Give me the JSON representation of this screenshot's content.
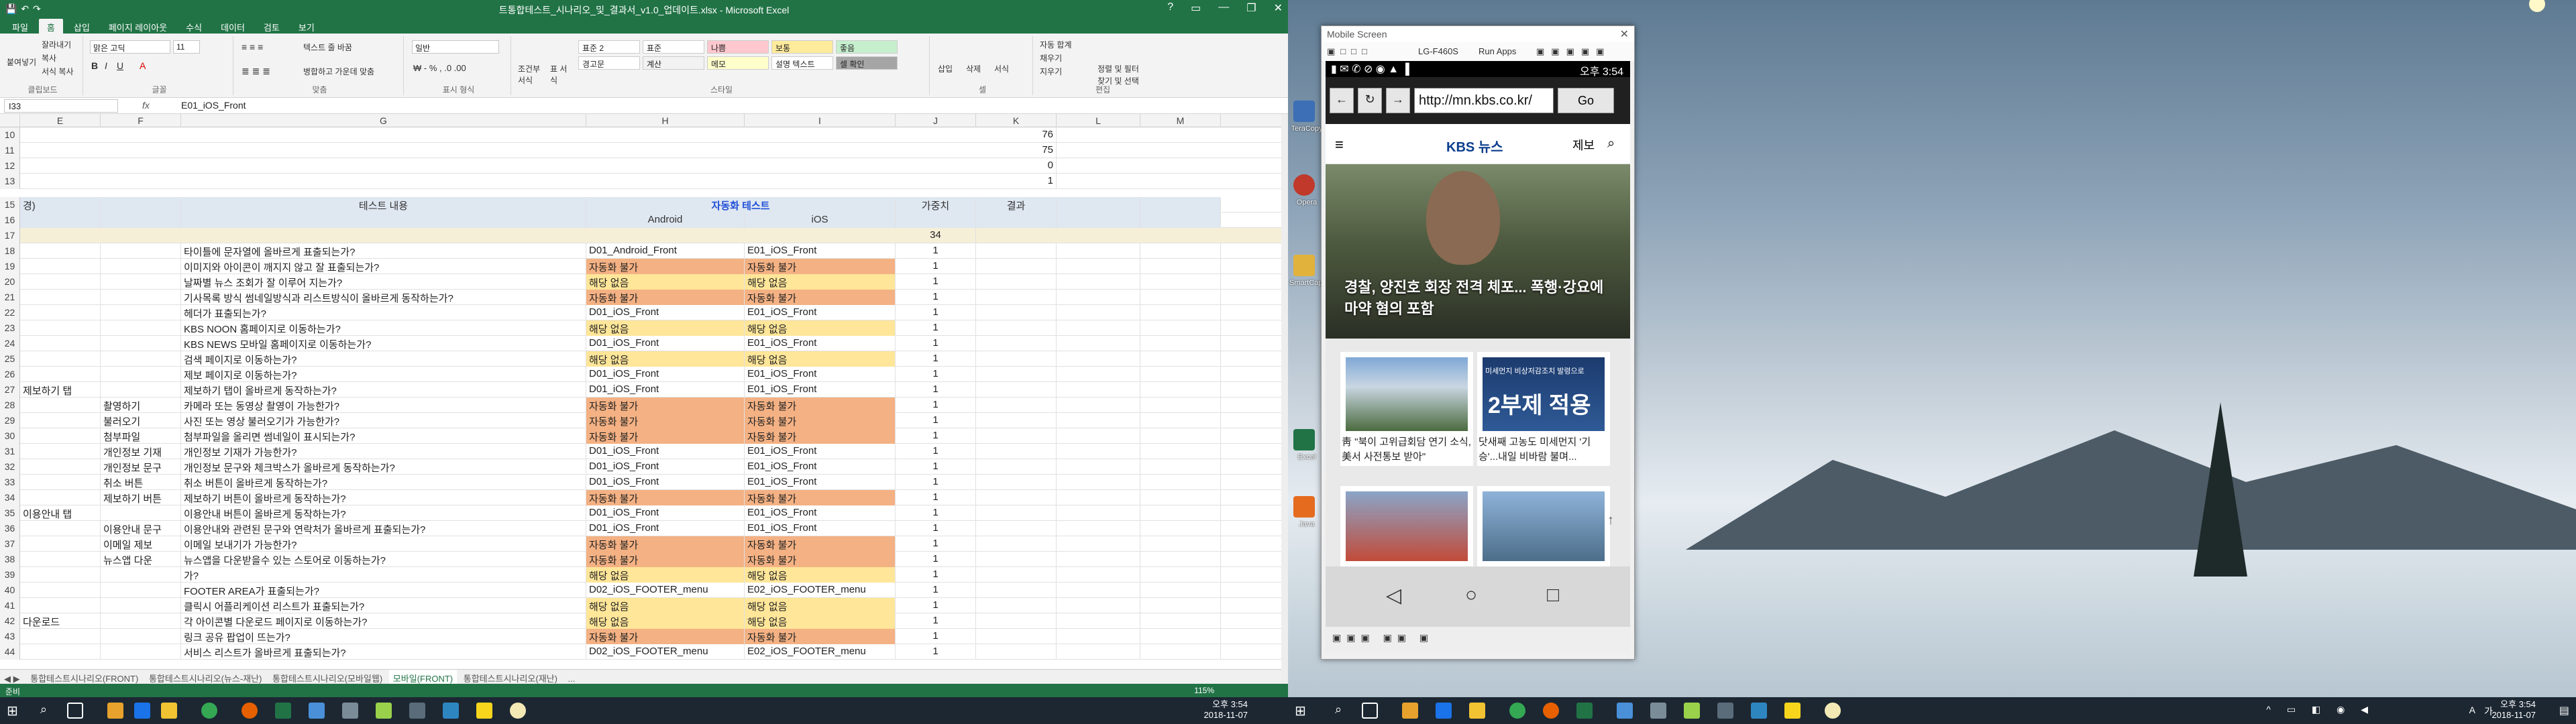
{
  "excel": {
    "title": "트통합테스트_시나리오_및_결과서_v1.0_업데이트.xlsx - Microsoft Excel",
    "ribbon_tabs": [
      "파일",
      "홈",
      "삽입",
      "페이지 레이아웃",
      "수식",
      "데이터",
      "검토",
      "보기"
    ],
    "ribbon": {
      "clipboard": {
        "cut": "잘라내기",
        "copy": "복사",
        "format_painter": "서식 복사",
        "paste": "붙여넣기",
        "label": "클립보드"
      },
      "font": {
        "name": "맑은 고딕",
        "size": "11",
        "label": "글꼴"
      },
      "alignment": {
        "wrap": "텍스트 줄 바꿈",
        "merge": "병합하고 가운데 맞춤",
        "label": "맞춤"
      },
      "number": {
        "format": "일반",
        "label": "표시 형식"
      },
      "styles": {
        "conditional": "조건부 서식",
        "table": "표 서식",
        "items": [
          {
            "label": "표준 2",
            "color": "#ffffff"
          },
          {
            "label": "표준",
            "color": "#ffffff"
          },
          {
            "label": "나쁨",
            "color": "#ffc7ce"
          },
          {
            "label": "보통",
            "color": "#ffeb9c"
          },
          {
            "label": "좋음",
            "color": "#c6efce"
          },
          {
            "label": "경고문",
            "color": "#ffffff"
          },
          {
            "label": "계산",
            "color": "#f2f2f2"
          },
          {
            "label": "메모",
            "color": "#ffffcc"
          },
          {
            "label": "설명 텍스트",
            "color": "#ffffff"
          },
          {
            "label": "셀 확인",
            "color": "#a5a5a5"
          }
        ],
        "label": "스타일"
      },
      "cells": {
        "insert": "삽입",
        "delete": "삭제",
        "format": "서식",
        "label": "셀"
      },
      "editing": {
        "autosum": "자동 합계",
        "fill": "채우기",
        "clear": "지우기",
        "sort": "정렬 및 필터",
        "find": "찾기 및 선택",
        "label": "편집"
      }
    },
    "name_box": "I33",
    "formula": "E01_iOS_Front",
    "columns": [
      "E",
      "F",
      "G",
      "H",
      "I",
      "J",
      "K",
      "L",
      "M"
    ],
    "top_rows": [
      {
        "row": "10",
        "k": "76"
      },
      {
        "row": "11",
        "k": "75"
      },
      {
        "row": "12",
        "k": "0"
      },
      {
        "row": "13",
        "k": "1"
      }
    ],
    "header_row15": {
      "row": "15",
      "e": "경)",
      "g": "테스트 내용",
      "hi": "자동화 테스트",
      "j": "가중치",
      "k": "결과"
    },
    "header_row16": {
      "row": "16",
      "h": "Android",
      "i": "iOS"
    },
    "header_row17": {
      "row": "17",
      "j": "34"
    },
    "rows": [
      {
        "row": "18",
        "e": "",
        "f": "",
        "g": "타이틀에 문자열에 올바르게 표출되는가?",
        "h": "D01_Android_Front",
        "i": "E01_iOS_Front",
        "j": "1",
        "status": "none"
      },
      {
        "row": "19",
        "e": "",
        "f": "",
        "g": "이미지와 아이콘이 깨지지 않고 잘 표출되는가?",
        "h": "자동화 불가",
        "i": "자동화 불가",
        "j": "1",
        "status": "orange"
      },
      {
        "row": "20",
        "e": "",
        "f": "",
        "g": "날짜별 뉴스 조회가 잘 이루어 지는가?",
        "h": "해당 없음",
        "i": "해당 없음",
        "j": "1",
        "status": "yellow"
      },
      {
        "row": "21",
        "e": "",
        "f": "",
        "g": "기사목록 방식 썸네일방식과 리스트방식이 올바르게 동작하는가?",
        "h": "자동화 불가",
        "i": "자동화 불가",
        "j": "1",
        "status": "orange"
      },
      {
        "row": "22",
        "e": "",
        "f": "",
        "g": "헤더가 표출되는가?",
        "h": "D01_iOS_Front",
        "i": "E01_iOS_Front",
        "j": "1",
        "status": "none"
      },
      {
        "row": "23",
        "e": "",
        "f": "",
        "g": "KBS NOON 홈페이지로 이동하는가?",
        "h": "해당 없음",
        "i": "해당 없음",
        "j": "1",
        "status": "yellow"
      },
      {
        "row": "24",
        "e": "",
        "f": "",
        "g": "KBS NEWS 모바일 홈페이지로 이동하는가?",
        "h": "D01_iOS_Front",
        "i": "E01_iOS_Front",
        "j": "1",
        "status": "none"
      },
      {
        "row": "25",
        "e": "",
        "f": "",
        "g": "검색 페이지로 이동하는가?",
        "h": "해당 없음",
        "i": "해당 없음",
        "j": "1",
        "status": "yellow"
      },
      {
        "row": "26",
        "e": "",
        "f": "",
        "g": "제보 페이지로 이동하는가?",
        "h": "D01_iOS_Front",
        "i": "E01_iOS_Front",
        "j": "1",
        "status": "none"
      },
      {
        "row": "27",
        "e": "제보하기 탭",
        "f": "",
        "g": "제보하기 탭이 올바르게 동작하는가?",
        "h": "D01_iOS_Front",
        "i": "E01_iOS_Front",
        "j": "1",
        "status": "none"
      },
      {
        "row": "28",
        "e": "",
        "f": "촬영하기",
        "g": "카메라 또는 동영상 촬영이 가능한가?",
        "h": "자동화 불가",
        "i": "자동화 불가",
        "j": "1",
        "status": "orange"
      },
      {
        "row": "29",
        "e": "",
        "f": "불러오기",
        "g": "사진 또는 영상 불러오기가 가능한가?",
        "h": "자동화 불가",
        "i": "자동화 불가",
        "j": "1",
        "status": "orange"
      },
      {
        "row": "30",
        "e": "",
        "f": "첨부파일",
        "g": "첨부파일을 올리면 썸네일이 표시되는가?",
        "h": "자동화 불가",
        "i": "자동화 불가",
        "j": "1",
        "status": "orange"
      },
      {
        "row": "31",
        "e": "",
        "f": "개인정보 기재",
        "g": "개인정보 기재가 가능한가?",
        "h": "D01_iOS_Front",
        "i": "E01_iOS_Front",
        "j": "1",
        "status": "none"
      },
      {
        "row": "32",
        "e": "",
        "f": "개인정보 문구",
        "g": "개인정보 문구와 체크박스가 올바르게 동작하는가?",
        "h": "D01_iOS_Front",
        "i": "E01_iOS_Front",
        "j": "1",
        "status": "none"
      },
      {
        "row": "33",
        "e": "",
        "f": "취소 버튼",
        "g": "취소 버튼이 올바르게 동작하는가?",
        "h": "D01_iOS_Front",
        "i": "E01_iOS_Front",
        "j": "1",
        "status": "none"
      },
      {
        "row": "34",
        "e": "",
        "f": "제보하기 버튼",
        "g": "제보하기 버튼이 올바르게 동작하는가?",
        "h": "자동화 불가",
        "i": "자동화 불가",
        "j": "1",
        "status": "orange"
      },
      {
        "row": "35",
        "e": "이용안내 탭",
        "f": "",
        "g": "이용안내 버튼이 올바르게 동작하는가?",
        "h": "D01_iOS_Front",
        "i": "E01_iOS_Front",
        "j": "1",
        "status": "none"
      },
      {
        "row": "36",
        "e": "",
        "f": "이용안내 문구",
        "g": "이용안내와 관련된 문구와 연락처가 올바르게 표출되는가?",
        "h": "D01_iOS_Front",
        "i": "E01_iOS_Front",
        "j": "1",
        "status": "none"
      },
      {
        "row": "37",
        "e": "",
        "f": "이메일 제보",
        "g": "이메일 보내기가 가능한가?",
        "h": "자동화 불가",
        "i": "자동화 불가",
        "j": "1",
        "status": "orange"
      },
      {
        "row": "38",
        "e": "",
        "f": "뉴스앱 다운",
        "g": "뉴스앱을 다운받을수 있는 스토어로 이동하는가?",
        "h": "자동화 불가",
        "i": "자동화 불가",
        "j": "1",
        "status": "orange"
      },
      {
        "row": "39",
        "e": "",
        "f": "",
        "g": "가?",
        "h": "해당 없음",
        "i": "해당 없음",
        "j": "1",
        "status": "yellow"
      },
      {
        "row": "40",
        "e": "",
        "f": "",
        "g": "FOOTER AREA가 표출되는가?",
        "h": "D02_iOS_FOOTER_menu",
        "i": "E02_iOS_FOOTER_menu",
        "j": "1",
        "status": "none"
      },
      {
        "row": "41",
        "e": "",
        "f": "",
        "g": "클릭시 어플리케이션 리스트가 표출되는가?",
        "h": "해당 없음",
        "i": "해당 없음",
        "j": "1",
        "status": "yellow"
      },
      {
        "row": "42",
        "e": "다운로드",
        "f": "",
        "g": "각 아이콘별 다운로드 페이지로 이동하는가?",
        "h": "해당 없음",
        "i": "해당 없음",
        "j": "1",
        "status": "yellow"
      },
      {
        "row": "43",
        "e": "",
        "f": "",
        "g": "링크 공유 팝업이 뜨는가?",
        "h": "자동화 불가",
        "i": "자동화 불가",
        "j": "1",
        "status": "orange"
      },
      {
        "row": "44",
        "e": "",
        "f": "",
        "g": "서비스 리스트가 올바르게 표출되는가?",
        "h": "D02_iOS_FOOTER_menu",
        "i": "E02_iOS_FOOTER_menu",
        "j": "1",
        "status": "none"
      }
    ],
    "sheet_tabs": [
      "통합테스트시나리오(FRONT)",
      "통합테스트시나리오(뉴스-재난)",
      "통합테스트시나리오(모바일웹)",
      "모바일(FRONT)",
      "통합테스트시나리오(재난)",
      "..."
    ],
    "status": {
      "ready": "준비",
      "zoom": "115%"
    }
  },
  "mobile": {
    "window_title": "Mobile Screen",
    "device": "LG-F460S",
    "run_apps": "Run Apps",
    "status_time": "오후 3:54",
    "url": "http://mn.kbs.co.kr/",
    "go": "Go",
    "site": {
      "logo": "KBS 뉴스",
      "report": "제보"
    },
    "hero_caption": "경찰, 양진호 회장 전격 체포... 폭행·강요에 마약 혐의 포함",
    "cards": [
      {
        "text": "靑 \"북이 고위급회담 연기 소식, 美서 사전통보 받아\""
      },
      {
        "text": "닷새째 고농도 미세먼지 '기승'...내일 비바람 불며..."
      }
    ],
    "card_overlay": {
      "small": "미세먼지 비상저감조치 발령으로",
      "big": "2부제 적용"
    }
  },
  "taskbar": {
    "left": {
      "time": "오후 3:54",
      "date": "2018-11-07"
    },
    "right": {
      "time": "오후 3:54",
      "date": "2018-11-07",
      "ime": "A",
      "lang": "가"
    }
  },
  "desktop_icons": [
    "TeraCopy",
    "Opera",
    "SmartCapture",
    "Excel",
    "Java"
  ]
}
